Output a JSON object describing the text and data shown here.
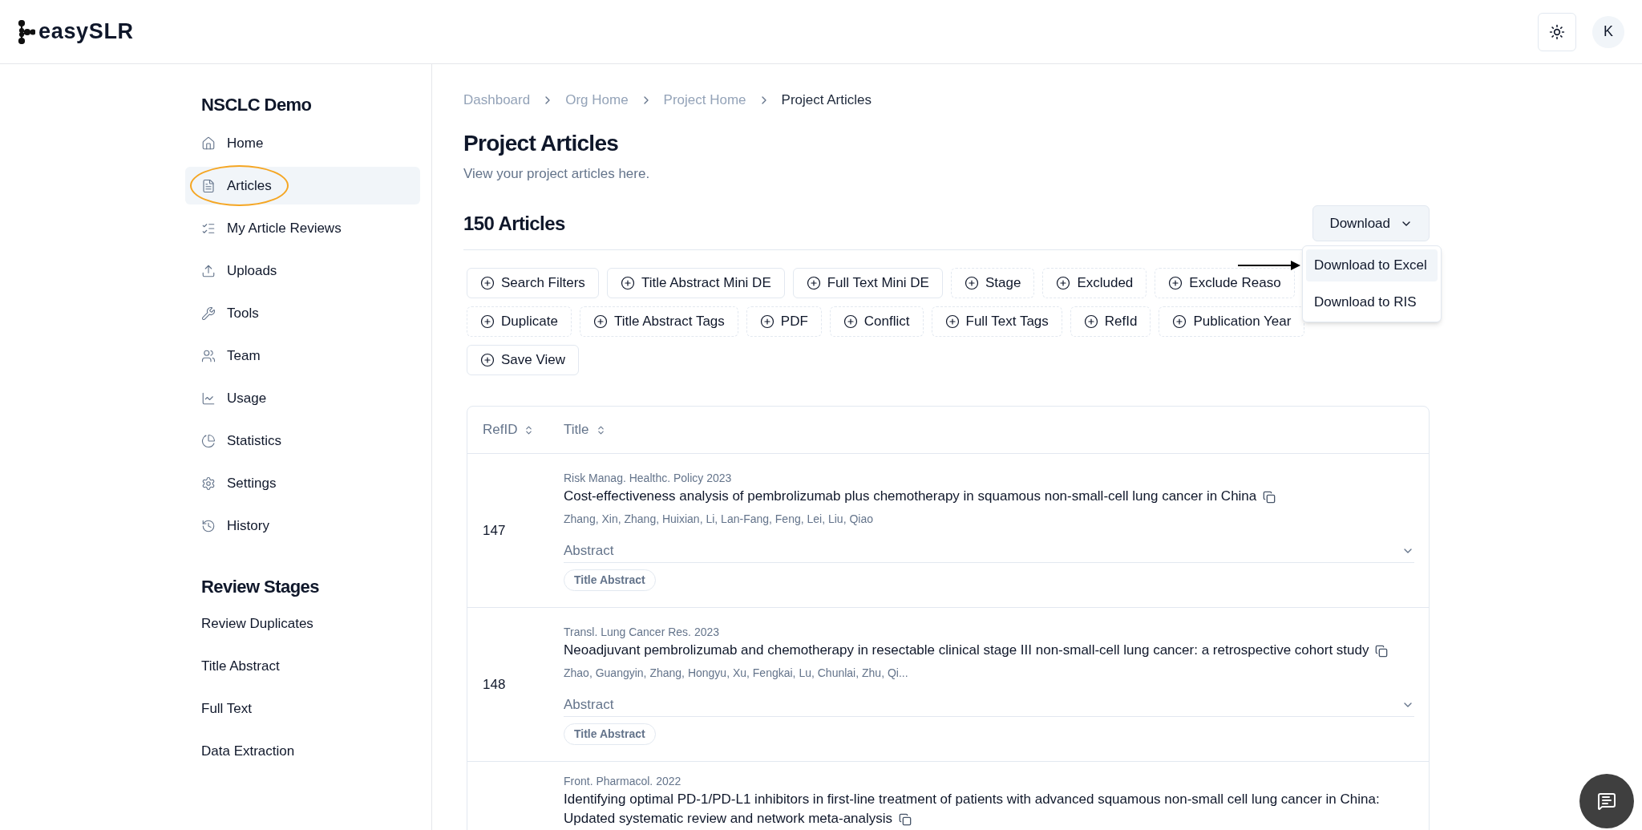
{
  "header": {
    "logo": "easySLR",
    "avatar": "K"
  },
  "sidebar": {
    "project": "NSCLC Demo",
    "items": [
      {
        "label": "Home",
        "selected": false,
        "circled": false
      },
      {
        "label": "Articles",
        "selected": true,
        "circled": true
      },
      {
        "label": "My Article Reviews",
        "selected": false,
        "circled": false
      },
      {
        "label": "Uploads",
        "selected": false,
        "circled": false
      },
      {
        "label": "Tools",
        "selected": false,
        "circled": false
      },
      {
        "label": "Team",
        "selected": false,
        "circled": false
      },
      {
        "label": "Usage",
        "selected": false,
        "circled": false
      },
      {
        "label": "Statistics",
        "selected": false,
        "circled": false
      },
      {
        "label": "Settings",
        "selected": false,
        "circled": false
      },
      {
        "label": "History",
        "selected": false,
        "circled": false
      }
    ],
    "stages_title": "Review Stages",
    "stages": [
      "Review Duplicates",
      "Title Abstract",
      "Full Text",
      "Data Extraction"
    ]
  },
  "breadcrumb": [
    {
      "label": "Dashboard",
      "current": false
    },
    {
      "label": "Org Home",
      "current": false
    },
    {
      "label": "Project Home",
      "current": false
    },
    {
      "label": "Project Articles",
      "current": true
    }
  ],
  "title": "Project Articles",
  "subtitle": "View your project articles here.",
  "count": "150 Articles",
  "download": {
    "label": "Download",
    "menu": [
      {
        "label": "Download to Excel",
        "selected": true,
        "pointed": true
      },
      {
        "label": "Download to RIS",
        "selected": false,
        "pointed": false
      }
    ]
  },
  "filters": [
    [
      {
        "label": "Search Filters",
        "kind": "solid"
      },
      {
        "label": "Title Abstract Mini DE",
        "kind": "solid"
      },
      {
        "label": "Full Text Mini DE",
        "kind": "solid"
      },
      {
        "label": "Stage",
        "kind": "dashed"
      },
      {
        "label": "Excluded",
        "kind": "dashed"
      },
      {
        "label": "Exclude Reaso",
        "kind": "dashed"
      }
    ],
    [
      {
        "label": "Duplicate",
        "kind": "dashed"
      },
      {
        "label": "Title Abstract Tags",
        "kind": "dashed"
      },
      {
        "label": "PDF",
        "kind": "dashed"
      },
      {
        "label": "Conflict",
        "kind": "dashed"
      },
      {
        "label": "Full Text Tags",
        "kind": "dashed"
      },
      {
        "label": "RefId",
        "kind": "dashed"
      },
      {
        "label": "Publication Year",
        "kind": "dashed"
      }
    ],
    [
      {
        "label": "Save View",
        "kind": "solid"
      }
    ]
  ],
  "table": {
    "columns": [
      "RefID",
      "Title"
    ],
    "rows": [
      {
        "refid": "147",
        "journal": "Risk Manag. Healthc. Policy 2023",
        "title": "Cost-effectiveness analysis of pembrolizumab plus chemotherapy in squamous non-small-cell lung cancer in China",
        "authors": "Zhang, Xin, Zhang, Huixian, Li, Lan-Fang, Feng, Lei, Liu, Qiao",
        "abstract": "Abstract",
        "tag": "Title Abstract"
      },
      {
        "refid": "148",
        "journal": "Transl. Lung Cancer Res. 2023",
        "title": "Neoadjuvant pembrolizumab and chemotherapy in resectable clinical stage III non-small-cell lung cancer: a retrospective cohort study",
        "authors": "Zhao, Guangyin, Zhang, Hongyu, Xu, Fengkai, Lu, Chunlai, Zhu, Qi...",
        "abstract": "Abstract",
        "tag": "Title Abstract"
      },
      {
        "journal": "Front. Pharmacol. 2022",
        "title": "Identifying optimal PD-1/PD-L1 inhibitors in first-line treatment of patients with advanced squamous non-small cell lung cancer in China: Updated systematic review and network meta-analysis"
      }
    ]
  }
}
